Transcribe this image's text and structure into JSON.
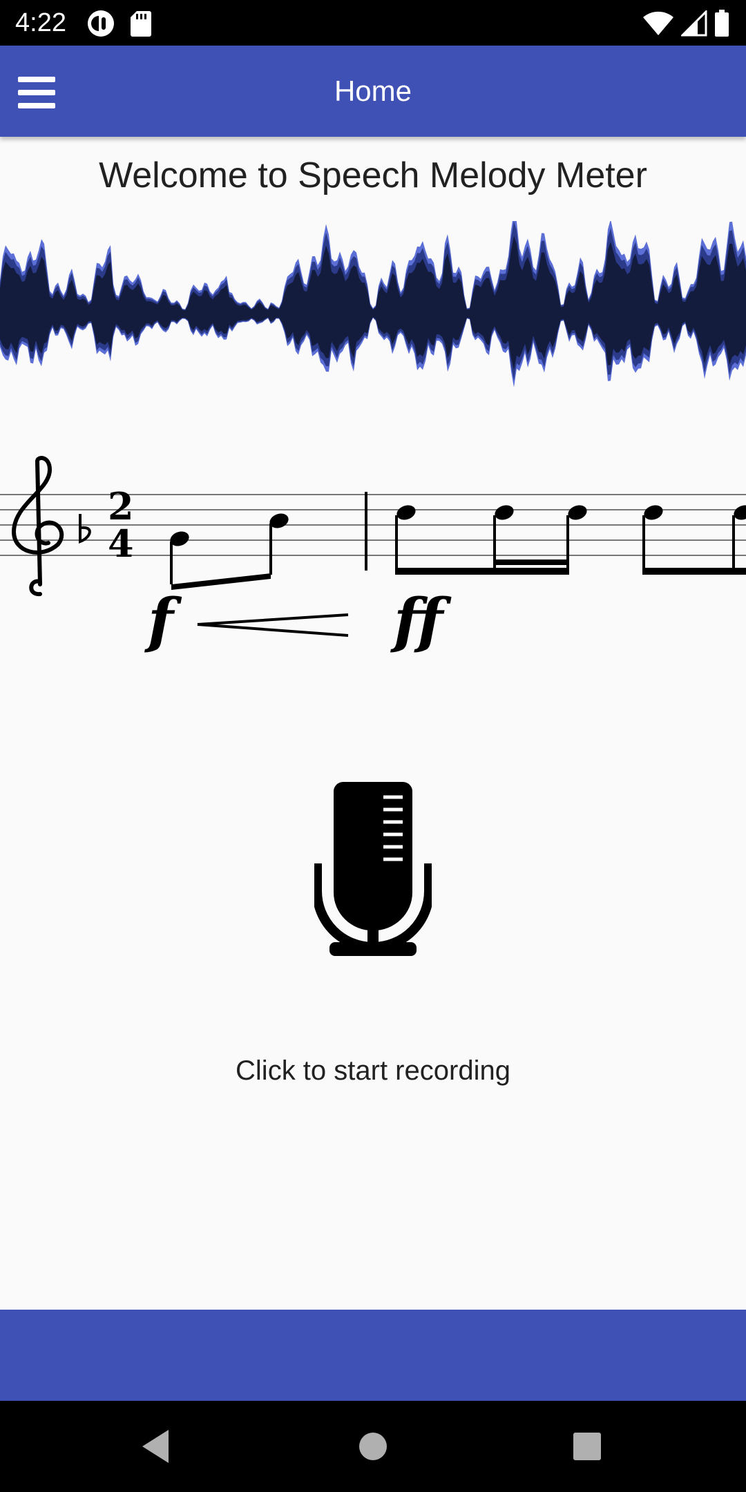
{
  "status_bar": {
    "time": "4:22",
    "left_icons": [
      "pocket-casts-icon",
      "sd-card-icon"
    ],
    "right_icons": [
      "wifi-icon",
      "signal-icon",
      "battery-icon"
    ]
  },
  "app_bar": {
    "title": "Home",
    "menu_icon": "hamburger-menu-icon",
    "color": "#3f51b5"
  },
  "main": {
    "welcome_text": "Welcome to Speech Melody Meter",
    "music_dynamics": [
      "f",
      "ff"
    ],
    "mic_icon": "microphone-icon",
    "record_hint": "Click to start recording"
  },
  "bottom_bar": {
    "color": "#3f51b5"
  },
  "nav_bar": {
    "buttons": [
      "back-icon",
      "home-icon",
      "recents-icon"
    ]
  }
}
